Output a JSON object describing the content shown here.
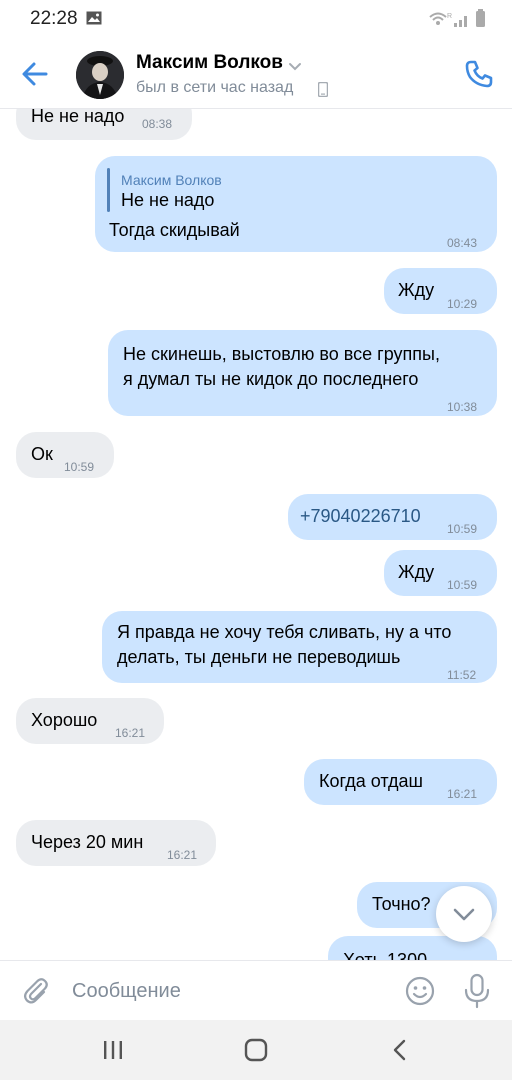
{
  "status_bar": {
    "time": "22:28"
  },
  "header": {
    "contact_name": "Максим Волков",
    "contact_status": "был в сети час назад"
  },
  "messages": [
    {
      "direction": "incoming",
      "text": "Не не надо",
      "time": "08:38"
    },
    {
      "direction": "outgoing",
      "reply_author": "Максим Волков",
      "reply_text": "Не не надо",
      "text": "Тогда скидывай",
      "time": "08:43"
    },
    {
      "direction": "outgoing",
      "text": "Жду",
      "time": "10:29"
    },
    {
      "direction": "outgoing",
      "text": "Не скинешь, выстовлю во все группы,\nя думал ты не кидок до последнего",
      "time": "10:38"
    },
    {
      "direction": "incoming",
      "text": "Ок",
      "time": "10:59"
    },
    {
      "direction": "outgoing",
      "text": "+79040226710",
      "time": "10:59"
    },
    {
      "direction": "outgoing",
      "text": "Жду",
      "time": "10:59"
    },
    {
      "direction": "outgoing",
      "text": "Я правда не хочу тебя сливать, ну а что\nделать, ты деньги не переводишь",
      "time": "11:52"
    },
    {
      "direction": "incoming",
      "text": "Хорошо",
      "time": "16:21"
    },
    {
      "direction": "outgoing",
      "text": "Когда отдаш",
      "time": "16:21"
    },
    {
      "direction": "incoming",
      "text": "Через 20 мин",
      "time": "16:21"
    },
    {
      "direction": "outgoing",
      "text": "Точно?",
      "time": ""
    },
    {
      "direction": "outgoing",
      "text": "Хоть 1300",
      "time": ""
    }
  ],
  "composer": {
    "placeholder": "Сообщение"
  },
  "icons": {
    "back": "arrow-left-icon",
    "call": "phone-icon",
    "attach": "paperclip-icon",
    "emoji": "smile-icon",
    "mic": "microphone-icon",
    "scroll_down": "chevron-down-icon"
  },
  "colors": {
    "accent": "#5181b8",
    "incoming_bubble": "#ebedf0",
    "outgoing_bubble": "#cce4ff",
    "secondary_text": "#818c99"
  }
}
